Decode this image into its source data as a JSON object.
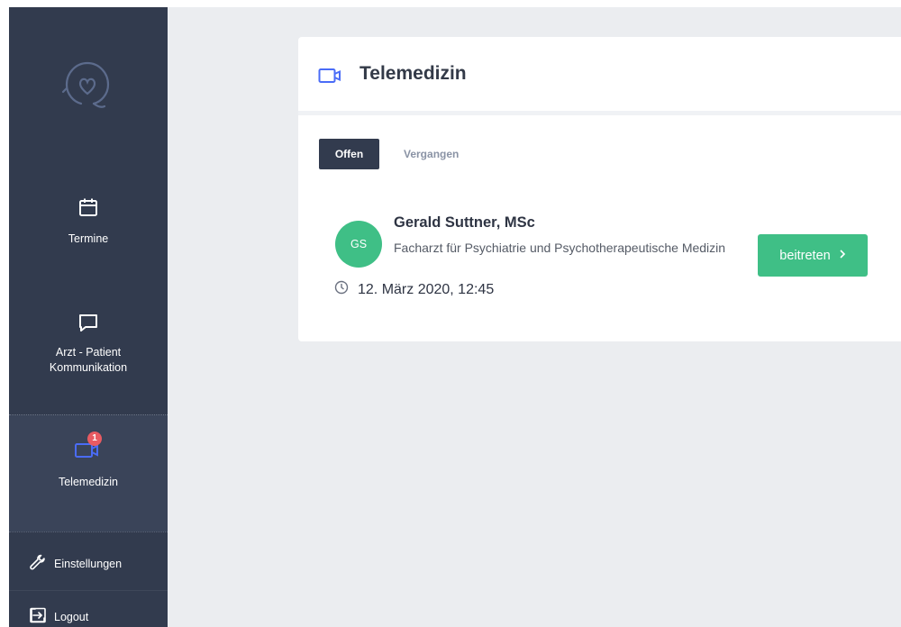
{
  "sidebar": {
    "logo_icon": "stethoscope-heart-icon",
    "items": [
      {
        "label": "Termine",
        "icon": "calendar-icon"
      },
      {
        "label": "Arzt - Patient\nKommunikation",
        "icon": "chat-bubble-icon"
      },
      {
        "label": "Telemedizin",
        "icon": "video-camera-icon",
        "badge": "1",
        "active": true
      }
    ],
    "settings_label": "Einstellungen",
    "settings_icon": "wrench-icon",
    "logout_label": "Logout",
    "logout_icon": "logout-icon"
  },
  "card": {
    "title": "Telemedizin",
    "title_icon": "video-camera-icon",
    "tabs": [
      {
        "label": "Offen",
        "active": true
      },
      {
        "label": "Vergangen",
        "active": false
      }
    ],
    "appointment": {
      "avatar_initials": "GS",
      "doctor_name": "Gerald Suttner, MSc",
      "specialty": "Facharzt für Psychiatrie und Psychotherapeutische Medizin",
      "datetime": "12. März 2020, 12:45",
      "time_icon": "clock-icon",
      "join_label": "beitreten",
      "join_icon": "chevron-right-icon"
    }
  },
  "colors": {
    "sidebar_bg": "#323b4e",
    "sidebar_active_bg": "#3a4459",
    "accent_green": "#3fbf86",
    "accent_blue": "#4a6cf7",
    "badge_red": "#e85b62",
    "page_bg": "#ebedf0"
  }
}
